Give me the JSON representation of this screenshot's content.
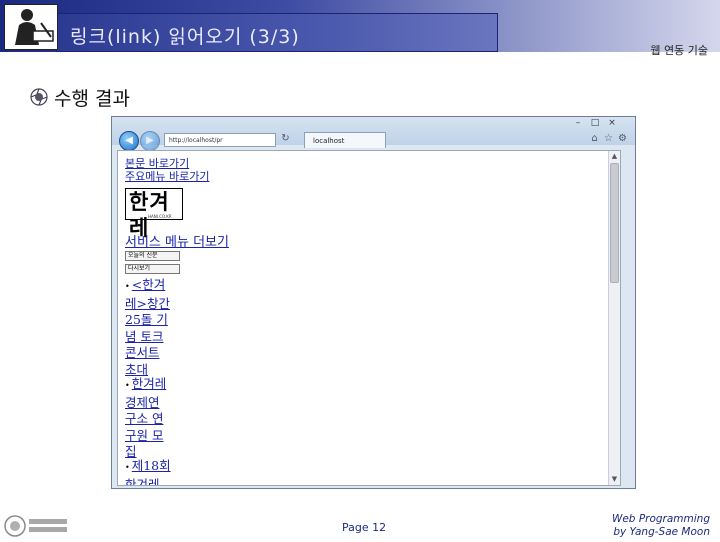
{
  "slide": {
    "title": "링크(link) 읽어오기 (3/3)",
    "subtitle": "웹 연동 기술",
    "section_title": "수행 결과",
    "page_number": "Page 12",
    "footer_line1": "Web Programming",
    "footer_line2": "by Yang-Sae Moon"
  },
  "browser": {
    "address": "http://localhost/pr",
    "tab_label": "localhost"
  },
  "webpage": {
    "top_links": [
      "본문 바로가기",
      "주요메뉴 바로가기"
    ],
    "logo_text": "한겨레",
    "logo_sub": "HANI.CO.KR",
    "service_link": "서비스 메뉴 더보기",
    "image_buttons": [
      "오늘의 신문",
      "다시보기"
    ],
    "news_items": [
      {
        "bullet": "•",
        "lines": [
          "<한겨",
          "레>창간",
          "25돌 기",
          "념 토크",
          "콘서트",
          "초대"
        ]
      },
      {
        "bullet": "•",
        "lines": [
          "한겨레",
          "경제연",
          "구소 연",
          "구원 모",
          "집"
        ]
      },
      {
        "bullet": "•",
        "lines": [
          "제18회",
          "한겨레"
        ]
      }
    ]
  }
}
